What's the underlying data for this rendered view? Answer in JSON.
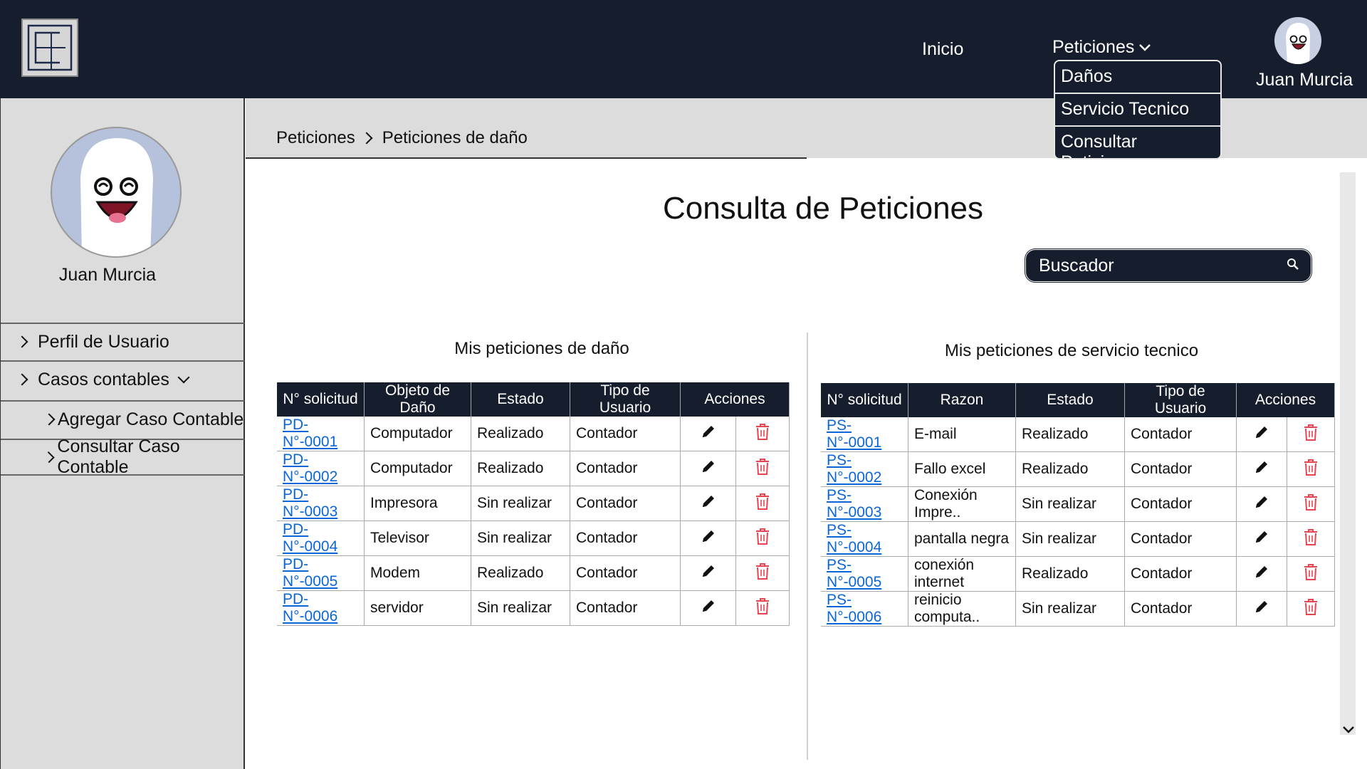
{
  "header": {
    "nav_inicio": "Inicio",
    "nav_peticiones": "Peticiones",
    "user_name": "Juan Murcia",
    "dropdown": [
      "Daños",
      "Servicio Tecnico",
      "Consultar Peticiones"
    ]
  },
  "sidebar": {
    "user_name": "Juan Murcia",
    "items": [
      "Perfil de Usuario",
      "Casos contables",
      "Agregar Caso Contable",
      "Consultar Caso Contable"
    ]
  },
  "breadcrumb": [
    "Peticiones",
    "Peticiones de daño"
  ],
  "main": {
    "title": "Consulta de Peticiones",
    "search_placeholder": "Buscador"
  },
  "damage": {
    "title": "Mis peticiones de daño",
    "headers": [
      "N° solicitud",
      "Objeto de Daño",
      "Estado",
      "Tipo de Usuario",
      "Acciones"
    ],
    "rows": [
      [
        "PD-N°-0001",
        "Computador",
        "Realizado",
        "Contador"
      ],
      [
        "PD-N°-0002",
        "Computador",
        "Realizado",
        "Contador"
      ],
      [
        "PD-N°-0003",
        "Impresora",
        "Sin realizar",
        "Contador"
      ],
      [
        "PD-N°-0004",
        "Televisor",
        "Sin realizar",
        "Contador"
      ],
      [
        "PD-N°-0005",
        "Modem",
        "Realizado",
        "Contador"
      ],
      [
        "PD-N°-0006",
        "servidor",
        "Sin realizar",
        "Contador"
      ]
    ]
  },
  "service": {
    "title": "Mis peticiones de servicio tecnico",
    "headers": [
      "N° solicitud",
      "Razon",
      "Estado",
      "Tipo de Usuario",
      "Acciones"
    ],
    "rows": [
      [
        "PS-N°-0001",
        "E-mail",
        "Realizado",
        "Contador"
      ],
      [
        "PS-N°-0002",
        "Fallo excel",
        "Realizado",
        "Contador"
      ],
      [
        "PS-N°-0003",
        "Conexión Impre..",
        "Sin realizar",
        "Contador"
      ],
      [
        "PS-N°-0004",
        "pantalla negra",
        "Sin realizar",
        "Contador"
      ],
      [
        "PS-N°-0005",
        "conexión internet",
        "Realizado",
        "Contador"
      ],
      [
        "PS-N°-0006",
        "reinicio computa..",
        "Sin realizar",
        "Contador"
      ]
    ]
  },
  "icons": {
    "edit": "pencil-icon",
    "delete": "trash-icon",
    "delete_color": "#e8434f",
    "brand_dark": "#161d2c"
  }
}
